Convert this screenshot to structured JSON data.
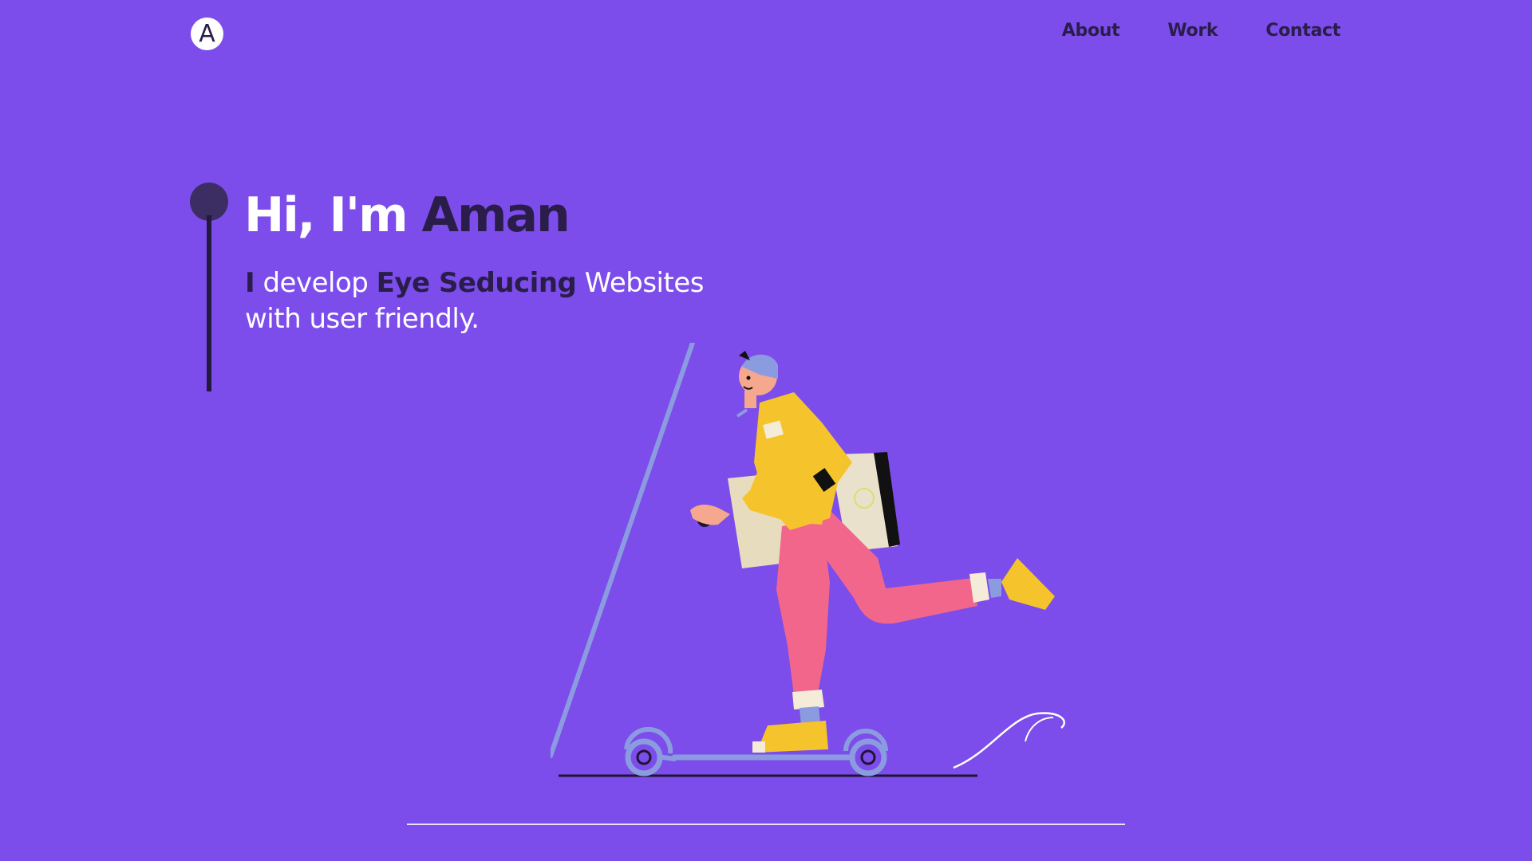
{
  "logo": {
    "letter": "A"
  },
  "nav": {
    "links": [
      {
        "label": "About"
      },
      {
        "label": "Work"
      },
      {
        "label": "Contact"
      }
    ]
  },
  "hero": {
    "greeting": "Hi, I'm",
    "name": "Aman",
    "sub_part1": "I",
    "sub_part2": "develop",
    "sub_highlight": "Eye Seducing",
    "sub_part3": "Websites",
    "sub_line2": "with user friendly."
  },
  "illustration": {
    "icon": "person-on-scooter-illustration"
  },
  "colors": {
    "background": "#7c4dea",
    "dark_text": "#2a1d4a",
    "light_text": "#ffffff",
    "timeline": "#23183d"
  }
}
